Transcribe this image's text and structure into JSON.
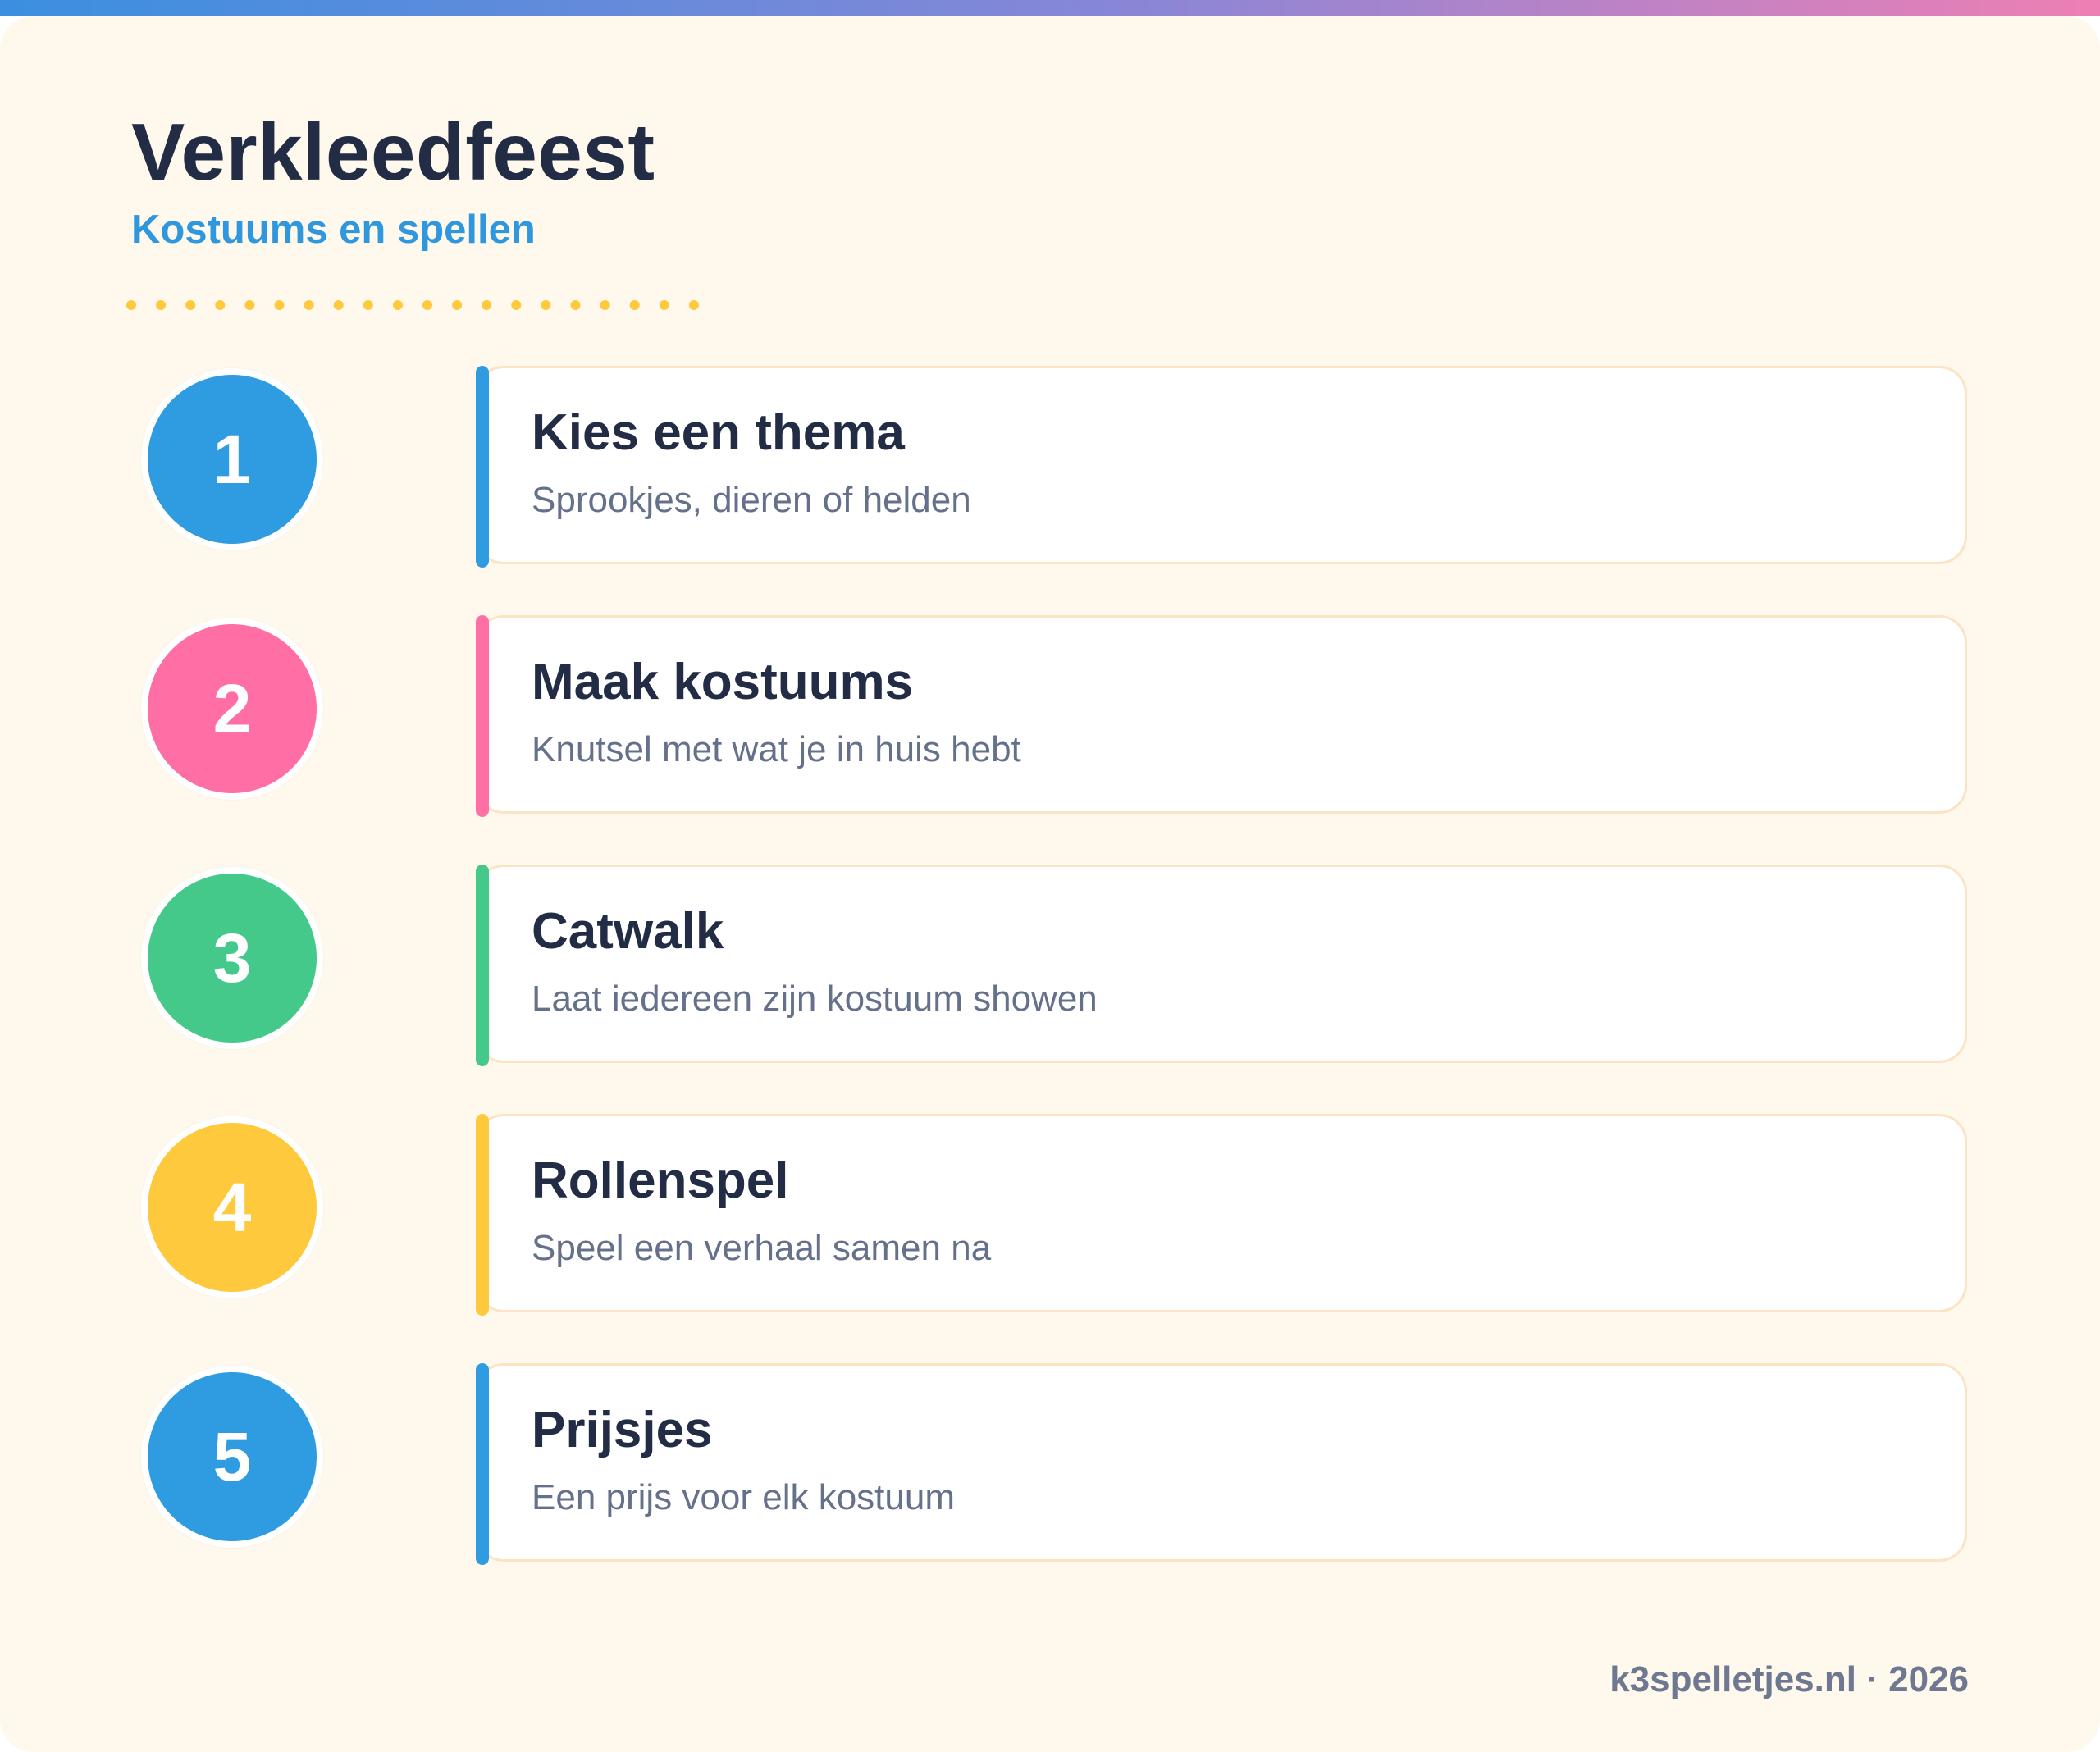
{
  "header": {
    "title": "Verkleedfeest",
    "subtitle": "Kostuums en spellen"
  },
  "colors": {
    "blue": "#2f9be0",
    "pink": "#ff6fa6",
    "green": "#45c98a",
    "yellow": "#ffc93d",
    "dots": "#ffc93d"
  },
  "steps": [
    {
      "number": "1",
      "title": "Kies een thema",
      "description": "Sprookjes, dieren of helden",
      "color": "#2f9be0"
    },
    {
      "number": "2",
      "title": "Maak kostuums",
      "description": "Knutsel met wat je in huis hebt",
      "color": "#ff6fa6"
    },
    {
      "number": "3",
      "title": "Catwalk",
      "description": "Laat iedereen zijn kostuum showen",
      "color": "#45c98a"
    },
    {
      "number": "4",
      "title": "Rollenspel",
      "description": "Speel een verhaal samen na",
      "color": "#ffc93d"
    },
    {
      "number": "5",
      "title": "Prijsjes",
      "description": "Een prijs voor elk kostuum",
      "color": "#2f9be0"
    }
  ],
  "footer": {
    "text": "k3spelletjes.nl · 2026"
  }
}
